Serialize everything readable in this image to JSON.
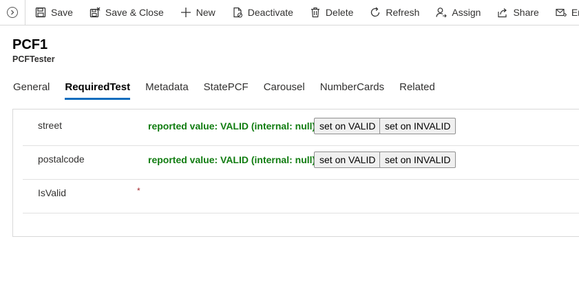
{
  "commandbar": {
    "items": [
      {
        "label": "Save",
        "icon": "save-icon"
      },
      {
        "label": "Save & Close",
        "icon": "save-close-icon"
      },
      {
        "label": "New",
        "icon": "plus-icon"
      },
      {
        "label": "Deactivate",
        "icon": "deactivate-icon"
      },
      {
        "label": "Delete",
        "icon": "trash-icon"
      },
      {
        "label": "Refresh",
        "icon": "refresh-icon"
      },
      {
        "label": "Assign",
        "icon": "assign-icon"
      },
      {
        "label": "Share",
        "icon": "share-icon"
      },
      {
        "label": "Ema",
        "icon": "email-icon"
      }
    ]
  },
  "header": {
    "title": "PCF1",
    "subtitle": "PCFTester"
  },
  "tabs": [
    {
      "label": "General",
      "active": false
    },
    {
      "label": "RequiredTest",
      "active": true
    },
    {
      "label": "Metadata",
      "active": false
    },
    {
      "label": "StatePCF",
      "active": false
    },
    {
      "label": "Carousel",
      "active": false
    },
    {
      "label": "NumberCards",
      "active": false
    },
    {
      "label": "Related",
      "active": false
    }
  ],
  "form": {
    "fields": [
      {
        "label": "street",
        "status": "reported value: VALID (internal: null)",
        "btn_valid": "set on VALID",
        "btn_invalid": "set on INVALID"
      },
      {
        "label": "postalcode",
        "status": "reported value: VALID (internal: null)",
        "btn_valid": "set on VALID",
        "btn_invalid": "set on INVALID"
      },
      {
        "label": "IsValid",
        "required_marker": "*"
      }
    ]
  },
  "colors": {
    "accent": "#0f6cbd",
    "status_valid": "#107c10",
    "required": "#a4262c"
  }
}
